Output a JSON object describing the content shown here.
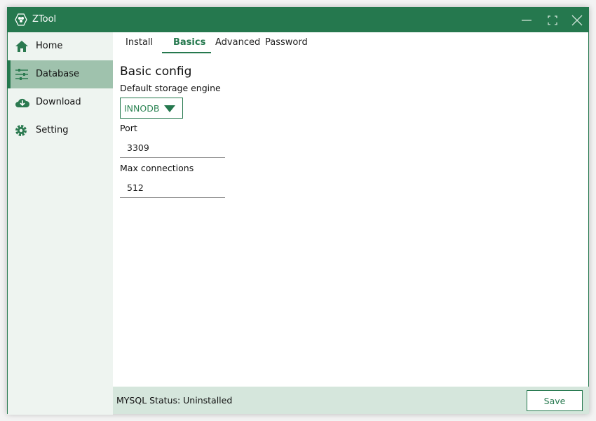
{
  "window": {
    "title": "ZTool",
    "accent": "#25784e"
  },
  "sidebar": {
    "items": [
      {
        "label": "Home",
        "icon": "home-icon"
      },
      {
        "label": "Database",
        "icon": "sliders-icon",
        "selected": true
      },
      {
        "label": "Download",
        "icon": "cloud-download-icon"
      },
      {
        "label": "Setting",
        "icon": "gear-icon"
      }
    ]
  },
  "tabs": [
    {
      "label": "Install"
    },
    {
      "label": "Basics",
      "selected": true
    },
    {
      "label": "Advanced"
    },
    {
      "label": "Password"
    }
  ],
  "form": {
    "heading": "Basic config",
    "engine_label": "Default storage engine",
    "engine_value": "INNODB",
    "port_label": "Port",
    "port_value": "3309",
    "maxconn_label": "Max connections",
    "maxconn_value": "512"
  },
  "status": {
    "text": "MYSQL Status: Uninstalled",
    "save_label": "Save"
  }
}
